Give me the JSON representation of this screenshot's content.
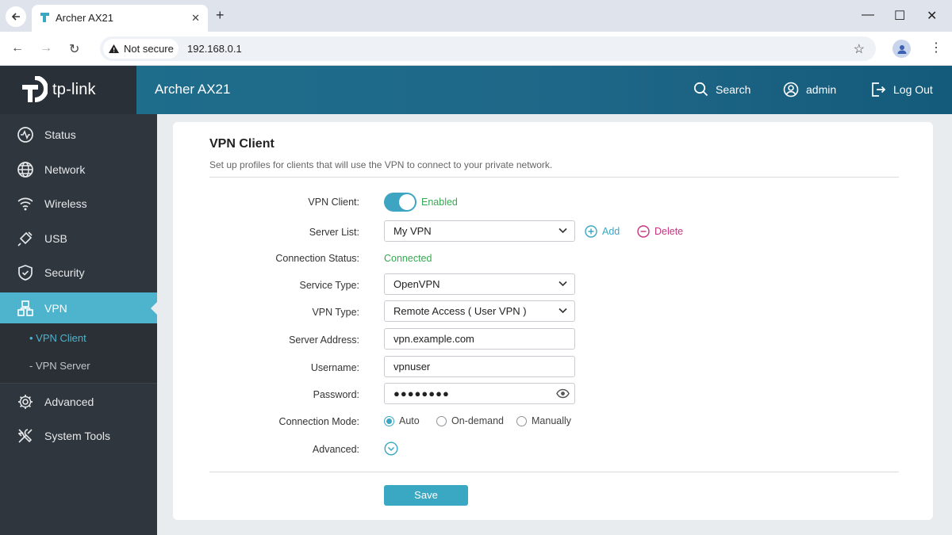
{
  "browser": {
    "tab_title": "Archer AX21",
    "security_label": "Not secure",
    "url": "192.168.0.1",
    "new_tab_glyph": "+",
    "close_glyph": "✕",
    "minimize_glyph": "—",
    "maximize_glyph": "☐",
    "close_window_glyph": "✕",
    "back_glyph": "←",
    "forward_glyph": "→",
    "reload_glyph": "↻",
    "star_glyph": "☆",
    "menu_glyph": "⋮"
  },
  "header": {
    "logo_text": "tp-link",
    "device_name": "Archer AX21",
    "search_label": "Search",
    "user_label": "admin",
    "logout_label": "Log Out"
  },
  "sidebar": {
    "items": [
      {
        "label": "Status",
        "icon": "status-icon"
      },
      {
        "label": "Network",
        "icon": "globe-icon"
      },
      {
        "label": "Wireless",
        "icon": "wifi-icon"
      },
      {
        "label": "USB",
        "icon": "usb-icon"
      },
      {
        "label": "Security",
        "icon": "shield-icon"
      },
      {
        "label": "VPN",
        "icon": "vpn-icon"
      },
      {
        "label": "Advanced",
        "icon": "gear-icon"
      },
      {
        "label": "System Tools",
        "icon": "tools-icon"
      }
    ],
    "active": "VPN",
    "submenu": [
      {
        "label": "• VPN Client",
        "active": true
      },
      {
        "label": "- VPN Server",
        "active": false
      }
    ]
  },
  "page": {
    "title": "VPN Client",
    "description": "Set up profiles for clients that will use the VPN to connect to your private network.",
    "fields": {
      "vpn_client_label": "VPN Client:",
      "vpn_client_state": "Enabled",
      "server_list_label": "Server List:",
      "server_list_value": "My VPN",
      "add_label": "Add",
      "delete_label": "Delete",
      "connection_status_label": "Connection Status:",
      "connection_status_value": "Connected",
      "service_type_label": "Service Type:",
      "service_type_value": "OpenVPN",
      "vpn_type_label": "VPN Type:",
      "vpn_type_value": "Remote Access ( User VPN )",
      "server_address_label": "Server Address:",
      "server_address_value": "vpn.example.com",
      "username_label": "Username:",
      "username_value": "vpnuser",
      "password_label": "Password:",
      "password_value": "●●●●●●●●",
      "connection_mode_label": "Connection Mode:",
      "connection_modes": [
        "Auto",
        "On-demand",
        "Manually"
      ],
      "connection_mode_selected": "Auto",
      "advanced_label": "Advanced:"
    },
    "save_label": "Save"
  },
  "colors": {
    "accent": "#3aa7c3",
    "success": "#37a852",
    "danger": "#c8327f",
    "sidebar_bg": "#2f363d",
    "header_bg": "#1d6f8c"
  }
}
